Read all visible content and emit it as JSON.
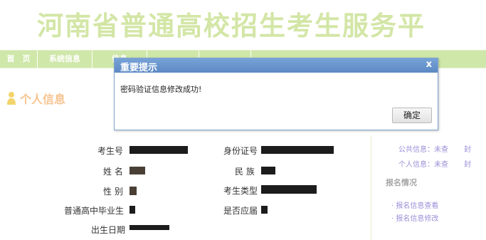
{
  "header": {
    "title": "河南省普通高校招生考生服务平"
  },
  "nav": {
    "items": [
      {
        "label": "首　页",
        "w": 52
      },
      {
        "label": "系统信息",
        "w": 76
      },
      {
        "label": "信息",
        "w": 76
      },
      {
        "label": "",
        "w": 72
      },
      {
        "label": "",
        "w": 72
      }
    ]
  },
  "section": {
    "title": "个人信息"
  },
  "info": {
    "exam_no_label": "考生号",
    "name_label": "姓 名",
    "gender_label": "性 别",
    "hs_grad_label": "普通高中毕业生",
    "birth_label": "出生日期",
    "id_label": "身份证号",
    "ethnic_label": "民 族",
    "type_label": "考生类型",
    "fresh_label": "是否应届"
  },
  "right_panel": {
    "public_info": "公共信息：未查",
    "public_val": "封",
    "personal_info": "个人信息：未查",
    "personal_val": "封",
    "signup_heading": "报名情况",
    "signup_view": "· 报名信息查看",
    "signup_edit": "· 报名信息修改"
  },
  "dialog": {
    "title": "重要提示",
    "close": "x",
    "message": "密码验证信息修改成功!",
    "ok_label": "确定"
  }
}
